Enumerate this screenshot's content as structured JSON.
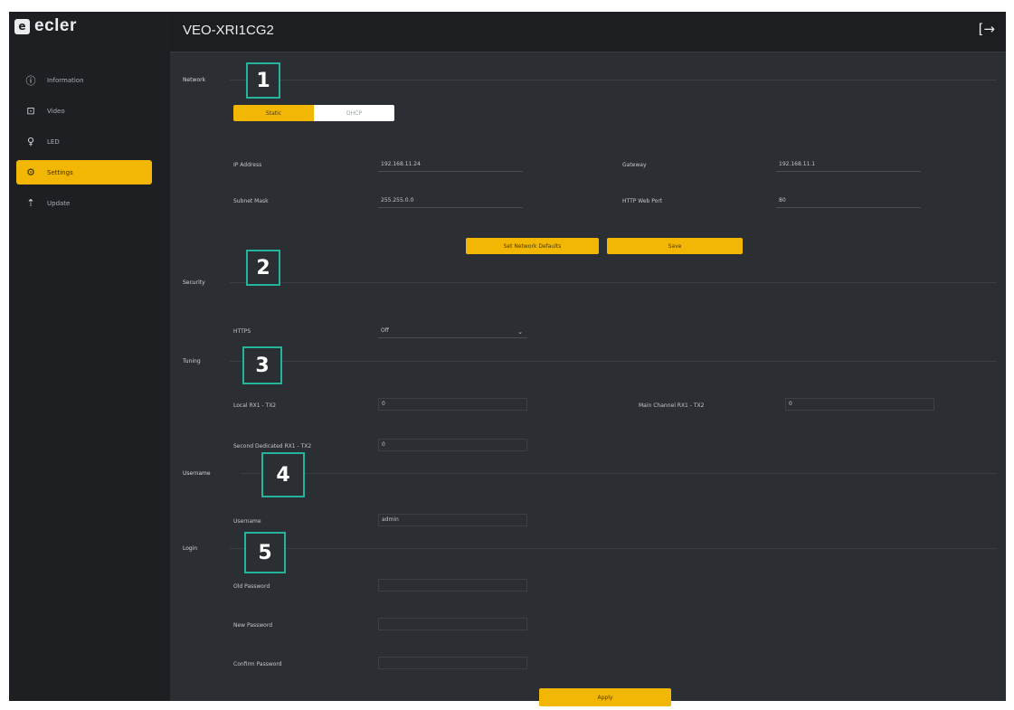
{
  "brand": {
    "logo_text": "ecler",
    "accent": "#f2b705",
    "marker_color": "#24b39b"
  },
  "header": {
    "title": "VEO-XRI1CG2",
    "logout_icon": "logout-icon"
  },
  "sidebar": {
    "items": [
      {
        "label": "Information",
        "icon": "info-icon"
      },
      {
        "label": "Video",
        "icon": "video-icon"
      },
      {
        "label": "LED",
        "icon": "led-icon"
      },
      {
        "label": "Settings",
        "icon": "settings-icon",
        "active": true
      },
      {
        "label": "Update",
        "icon": "update-icon"
      }
    ]
  },
  "network": {
    "label": "Network",
    "marker": "1",
    "mode_on": "Static",
    "mode_off": "DHCP",
    "ip_label": "IP Address",
    "ip_value": "192.168.11.24",
    "gateway_label": "Gateway",
    "gateway_value": "192.168.11.1",
    "mask_label": "Subnet Mask",
    "mask_value": "255.255.0.0",
    "http_label": "HTTP Web Port",
    "http_value": "80",
    "defaults_button": "Set Network Defaults",
    "save_button": "Save"
  },
  "security": {
    "label": "Security",
    "marker": "2",
    "https_label": "HTTPS",
    "https_value": "Off"
  },
  "tuning": {
    "label": "Tuning",
    "marker": "3",
    "local_label": "Local RX1 - TX2",
    "local_value": "0",
    "main_label": "Main Channel RX1 - TX2",
    "main_value": "0",
    "second_label": "Second Dedicated RX1 - TX2",
    "second_value": "0"
  },
  "username": {
    "label": "Username",
    "marker": "4",
    "field_label": "Username",
    "field_value": "admin"
  },
  "login": {
    "label": "Login",
    "marker": "5",
    "old_label": "Old Password",
    "new_label": "New Password",
    "confirm_label": "Confirm Password",
    "apply_button": "Apply"
  }
}
